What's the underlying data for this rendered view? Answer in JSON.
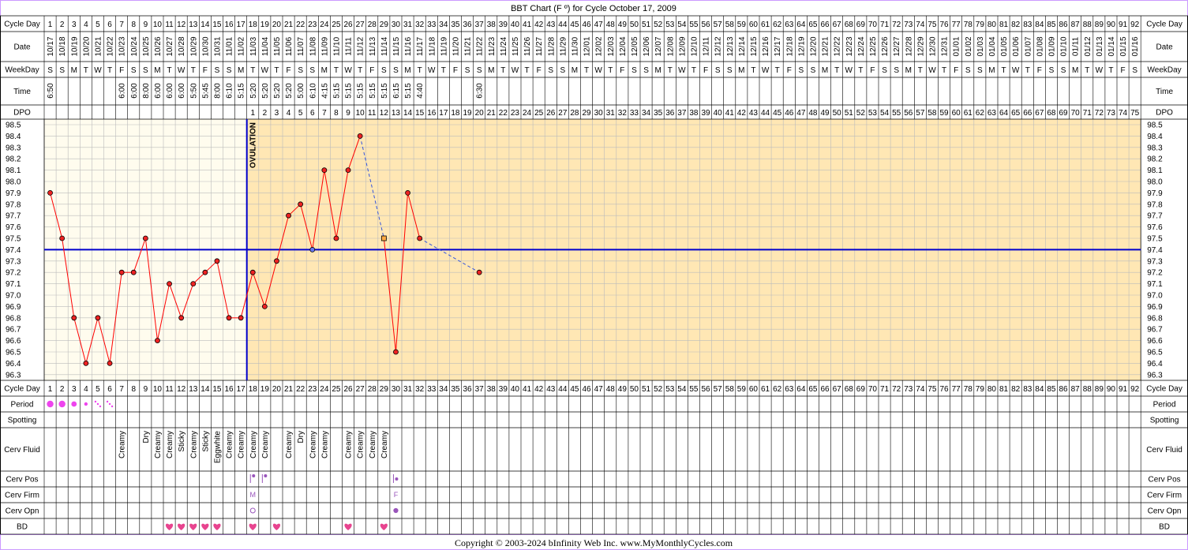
{
  "title": "BBT Chart (F º) for Cycle October 17, 2009",
  "copyright": "Copyright © 2003-2024 bInfinity Web Inc.     www.MyMonthlyCycles.com",
  "row_labels": {
    "cycle_day": "Cycle Day",
    "date": "Date",
    "weekday": "WeekDay",
    "time": "Time",
    "dpo": "DPO",
    "period": "Period",
    "spotting": "Spotting",
    "cerv_fluid": "Cerv Fluid",
    "cerv_pos": "Cerv Pos",
    "cerv_firm": "Cerv Firm",
    "cerv_opn": "Cerv Opn",
    "bd": "BD"
  },
  "ovulation_label": "OVULATION",
  "colors": {
    "pre_ovulation_bg": "#FFFCEE",
    "post_ovulation_bg": "#FFE7B4",
    "grid": "#BBBBBB",
    "temp_line": "#FF0000",
    "coverline": "#0000CC",
    "point_fill": "#EE2222",
    "border_lavender": "#CC99FF",
    "period_dot": "#EE44EE",
    "heart": "#E8448F",
    "cerv_mark": "#9955BB"
  },
  "chart_data": {
    "type": "line",
    "ylim": [
      96.3,
      98.5
    ],
    "y_ticks": [
      "98.5",
      "98.4",
      "98.3",
      "98.2",
      "98.1",
      "98.0",
      "97.9",
      "97.8",
      "97.7",
      "97.6",
      "97.5",
      "97.4",
      "97.3",
      "97.2",
      "97.1",
      "97.0",
      "96.9",
      "96.8",
      "96.7",
      "96.6",
      "96.5",
      "96.4",
      "96.3"
    ],
    "cycle_days": [
      1,
      2,
      3,
      4,
      5,
      6,
      7,
      8,
      9,
      10,
      11,
      12,
      13,
      14,
      15,
      16,
      17,
      18,
      19,
      20,
      21,
      22,
      23,
      24,
      25,
      26,
      27,
      28,
      29,
      30,
      31,
      32,
      33,
      34,
      35,
      36,
      37,
      38,
      39,
      40,
      41,
      42,
      43,
      44,
      45,
      46,
      47,
      48,
      49,
      50,
      51,
      52,
      53,
      54,
      55,
      56,
      57,
      58,
      59,
      60,
      61,
      62,
      63,
      64,
      65,
      66,
      67,
      68,
      69,
      70,
      71,
      72,
      73,
      74,
      75,
      76,
      77,
      78,
      79,
      80,
      81,
      82,
      83,
      84,
      85,
      86,
      87,
      88,
      89,
      90,
      91,
      92
    ],
    "dates": [
      "10/17",
      "10/18",
      "10/19",
      "10/20",
      "10/21",
      "10/22",
      "10/23",
      "10/24",
      "10/25",
      "10/26",
      "10/27",
      "10/28",
      "10/29",
      "10/30",
      "10/31",
      "11/01",
      "11/02",
      "11/03",
      "11/04",
      "11/05",
      "11/06",
      "11/07",
      "11/08",
      "11/09",
      "11/10",
      "11/11",
      "11/12",
      "11/13",
      "11/14",
      "11/15",
      "11/16",
      "11/17",
      "11/18",
      "11/19",
      "11/20",
      "11/21",
      "11/22",
      "11/23",
      "11/24",
      "11/25",
      "11/26",
      "11/27",
      "11/28",
      "11/29",
      "11/30",
      "12/01",
      "12/02",
      "12/03",
      "12/04",
      "12/05",
      "12/06",
      "12/07",
      "12/08",
      "12/09",
      "12/10",
      "12/11",
      "12/12",
      "12/13",
      "12/14",
      "12/15",
      "12/16",
      "12/17",
      "12/18",
      "12/19",
      "12/20",
      "12/21",
      "12/22",
      "12/23",
      "12/24",
      "12/25",
      "12/26",
      "12/27",
      "12/28",
      "12/29",
      "12/30",
      "12/31",
      "01/01",
      "01/02",
      "01/03",
      "01/04",
      "01/05",
      "01/06",
      "01/07",
      "01/08",
      "01/09",
      "01/10",
      "01/11",
      "01/12",
      "01/13",
      "01/14",
      "01/15",
      "01/16"
    ],
    "weekdays": [
      "S",
      "S",
      "M",
      "T",
      "W",
      "T",
      "F",
      "S",
      "S",
      "M",
      "T",
      "W",
      "T",
      "F",
      "S",
      "S",
      "M",
      "T",
      "W",
      "T",
      "F",
      "S",
      "S",
      "M",
      "T",
      "W",
      "T",
      "F",
      "S",
      "S",
      "M",
      "T",
      "W",
      "T",
      "F",
      "S",
      "S",
      "M",
      "T",
      "W",
      "T",
      "F",
      "S",
      "S",
      "M",
      "T",
      "W",
      "T",
      "F",
      "S",
      "S",
      "M",
      "T",
      "W",
      "T",
      "F",
      "S",
      "S",
      "M",
      "T",
      "W",
      "T",
      "F",
      "S",
      "S",
      "M",
      "T",
      "W",
      "T",
      "F",
      "S",
      "S",
      "M",
      "T",
      "W",
      "T",
      "F",
      "S",
      "S",
      "M",
      "T",
      "W",
      "T",
      "F",
      "S",
      "S",
      "M",
      "T",
      "W",
      "T",
      "F",
      "S"
    ],
    "times": [
      "6:50",
      "",
      "",
      "",
      "",
      "",
      "6:00",
      "6:00",
      "8:00",
      "6:00",
      "6:00",
      "6:00",
      "5:50",
      "5:45",
      "8:00",
      "6:10",
      "5:15",
      "5:20",
      "5:20",
      "5:20",
      "5:20",
      "5:00",
      "6:10",
      "4:15",
      "5:15",
      "5:15",
      "5:15",
      "5:15",
      "5:15",
      "6:15",
      "5:15",
      "4:40",
      "",
      "",
      "",
      "",
      "6:30"
    ],
    "dpo": [
      "",
      "",
      "",
      "",
      "",
      "",
      "",
      "",
      "",
      "",
      "",
      "",
      "",
      "",
      "",
      "",
      "",
      "1",
      "2",
      "3",
      "4",
      "5",
      "6",
      "7",
      "8",
      "9",
      "10",
      "11",
      "12",
      "13",
      "14",
      "15",
      "16",
      "17",
      "18",
      "19",
      "20",
      "21",
      "22",
      "23",
      "24",
      "25",
      "26",
      "27",
      "28",
      "29",
      "30",
      "31",
      "32",
      "33",
      "34",
      "35",
      "36",
      "37",
      "38",
      "39",
      "40",
      "41",
      "42",
      "43",
      "44",
      "45",
      "46",
      "47",
      "48",
      "49",
      "50",
      "51",
      "52",
      "53",
      "54",
      "55",
      "56",
      "57",
      "58",
      "59",
      "60",
      "61",
      "62",
      "63",
      "64",
      "65",
      "66",
      "67",
      "68",
      "69",
      "70",
      "71",
      "72",
      "73",
      "74",
      "75"
    ],
    "temps": [
      97.9,
      97.5,
      96.8,
      96.4,
      96.8,
      96.4,
      97.2,
      97.2,
      97.5,
      96.6,
      97.1,
      96.8,
      97.1,
      97.2,
      97.3,
      96.8,
      96.8,
      97.2,
      96.9,
      97.3,
      97.7,
      97.8,
      97.4,
      98.1,
      97.5,
      98.1,
      98.4,
      null,
      97.5,
      96.5,
      97.9,
      97.5,
      null,
      null,
      null,
      null,
      97.2
    ],
    "excluded_temps": [
      {
        "day": 29,
        "value": 97.5
      }
    ],
    "coverline": 97.4,
    "ovulation_day": 17,
    "period": [
      3,
      3,
      2,
      1,
      0.5,
      0.5
    ],
    "cerv_fluid": [
      "",
      "",
      "",
      "",
      "",
      "",
      "Creamy",
      "",
      "Dry",
      "Creamy",
      "Creamy",
      "Sticky",
      "Creamy",
      "Sticky",
      "Eggwhite",
      "Creamy",
      "Creamy",
      "Creamy",
      "Creamy",
      "",
      "Creamy",
      "Dry",
      "Creamy",
      "Creamy",
      "",
      "Creamy",
      "Creamy",
      "Creamy",
      "Creamy"
    ],
    "cerv_pos": {
      "18": "high",
      "19": "high",
      "30": "mid"
    },
    "cerv_firm": {
      "18": "M",
      "30": "F"
    },
    "cerv_opn": {
      "18": "open",
      "30": "closed"
    },
    "bd": [
      11,
      12,
      13,
      14,
      15,
      18,
      20,
      26,
      29
    ]
  }
}
